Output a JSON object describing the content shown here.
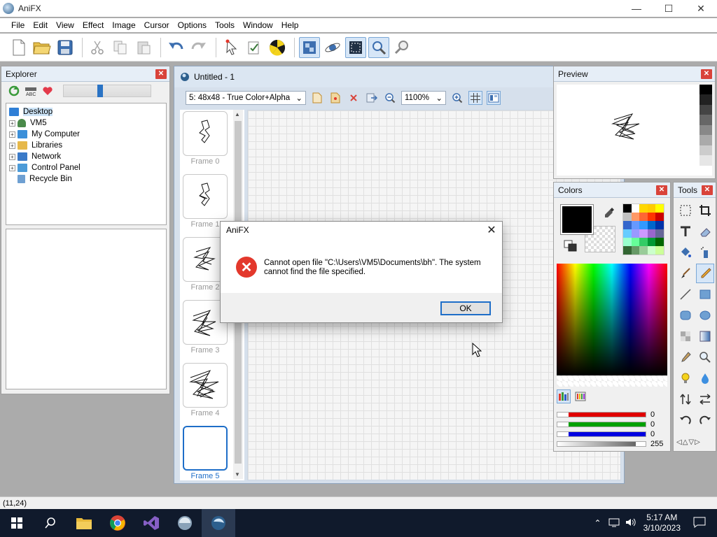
{
  "app": {
    "title": "AniFX"
  },
  "window_controls": {
    "minimize": "—",
    "maximize": "☐",
    "close": "✕"
  },
  "menu": [
    "File",
    "Edit",
    "View",
    "Effect",
    "Image",
    "Cursor",
    "Options",
    "Tools",
    "Window",
    "Help"
  ],
  "explorer": {
    "title": "Explorer",
    "tree": [
      {
        "label": "Desktop",
        "expander": "",
        "icon_color": "#2f7fd6",
        "selected": true
      },
      {
        "label": "VM5",
        "expander": "+",
        "icon_color": "#4a8a4a"
      },
      {
        "label": "My Computer",
        "expander": "+",
        "icon_color": "#3b8fd9"
      },
      {
        "label": "Libraries",
        "expander": "+",
        "icon_color": "#e6b84a"
      },
      {
        "label": "Network",
        "expander": "+",
        "icon_color": "#3a7ac8"
      },
      {
        "label": "Control Panel",
        "expander": "+",
        "icon_color": "#4c9bd8"
      },
      {
        "label": "Recycle Bin",
        "expander": "",
        "icon_color": "#6fa0d2"
      }
    ]
  },
  "document": {
    "title": "Untitled - 1",
    "format_select": "5: 48x48 - True Color+Alpha",
    "zoom_select": "1100%",
    "frames": [
      "Frame 0",
      "Frame 1",
      "Frame 2",
      "Frame 3",
      "Frame 4",
      "Frame 5"
    ]
  },
  "preview": {
    "title": "Preview"
  },
  "colors": {
    "title": "Colors",
    "primary_color": "#000000",
    "rgb": {
      "r": "0",
      "g": "0",
      "b": "0",
      "a": "255"
    },
    "palette": [
      "#000000",
      "#ffffff",
      "#ffd700",
      "#ffcc00",
      "#ffff00",
      "#c0c0c0",
      "#ff9966",
      "#ff6633",
      "#ff3300",
      "#cc0000",
      "#3366cc",
      "#6699ff",
      "#3399ff",
      "#0066cc",
      "#0033aa",
      "#66ccff",
      "#9999ff",
      "#cc99ff",
      "#9966cc",
      "#666699",
      "#99ffcc",
      "#66ff99",
      "#33cc66",
      "#009933",
      "#006600",
      "#336633",
      "#669966",
      "#99cc99",
      "#ccffcc",
      "#ccff99"
    ]
  },
  "tools": {
    "title": "Tools"
  },
  "status": {
    "coords": "(11,24)"
  },
  "taskbar": {
    "time": "5:17 AM",
    "date": "3/10/2023"
  },
  "dialog": {
    "title": "AniFX",
    "message": "Cannot open file \"C:\\Users\\VM5\\Documents\\bh\". The system cannot find the file specified.",
    "ok_label": "OK"
  }
}
